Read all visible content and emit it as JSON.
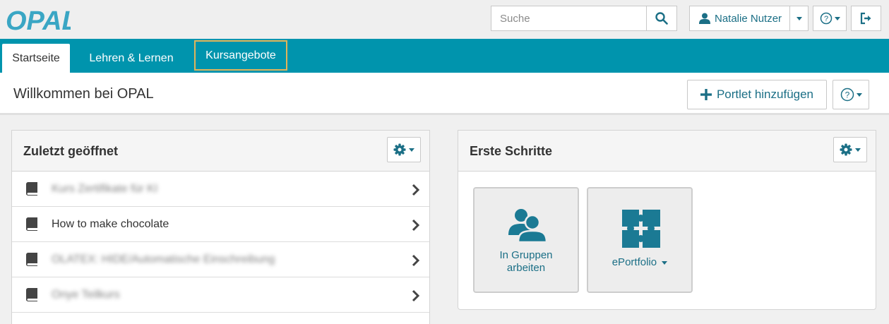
{
  "header": {
    "logo_text": "OPAL",
    "search": {
      "placeholder": "Suche",
      "value": ""
    },
    "user": {
      "name": "Natalie Nutzer"
    }
  },
  "nav": {
    "tabs": [
      {
        "label": "Startseite",
        "active": true
      },
      {
        "label": "Lehren & Lernen",
        "active": false
      },
      {
        "label": "Kursangebote",
        "active": false,
        "highlighted": true
      }
    ]
  },
  "page": {
    "title": "Willkommen bei OPAL",
    "add_portlet_label": "Portlet hinzufügen"
  },
  "recent": {
    "title": "Zuletzt geöffnet",
    "items": [
      {
        "label": "Kurs Zertifikate für KI",
        "obscured": true
      },
      {
        "label": "How to make chocolate",
        "obscured": false
      },
      {
        "label": "OLATEX: HIDE/Automatische Einschreibung",
        "obscured": true
      },
      {
        "label": "Onye Teilkurs",
        "obscured": true
      }
    ]
  },
  "first_steps": {
    "title": "Erste Schritte",
    "tiles": [
      {
        "label_line1": "In Gruppen",
        "label_line2": "arbeiten",
        "icon": "users-icon"
      },
      {
        "label": "ePortfolio",
        "icon": "puzzle-icon"
      }
    ]
  },
  "colors": {
    "brand": "#0094ad",
    "accent_text": "#1b6f86",
    "highlight_border": "#e2b45a"
  }
}
